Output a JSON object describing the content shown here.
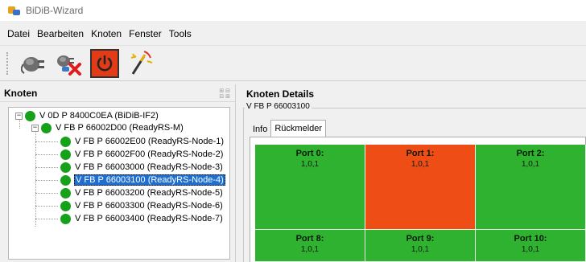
{
  "window": {
    "title": "BiDiB-Wizard"
  },
  "menu": [
    "Datei",
    "Bearbeiten",
    "Knoten",
    "Fenster",
    "Tools"
  ],
  "toolbar": {
    "buttons": [
      {
        "icon": "plug-connect-icon"
      },
      {
        "icon": "plug-disconnect-icon"
      },
      {
        "icon": "power-icon",
        "accent": "#e23b16"
      },
      {
        "icon": "magic-wand-icon"
      }
    ]
  },
  "left": {
    "header": "Knoten",
    "tree": [
      {
        "label": "V 0D P 8400C0EA (BiDiB-IF2)",
        "level": 0,
        "expander": "−"
      },
      {
        "label": "V FB P 66002D00 (ReadyRS-M)",
        "level": 1,
        "expander": "−"
      },
      {
        "label": "V FB P 66002E00 (ReadyRS-Node-1)",
        "level": 2
      },
      {
        "label": "V FB P 66002F00 (ReadyRS-Node-2)",
        "level": 2
      },
      {
        "label": "V FB P 66003000 (ReadyRS-Node-3)",
        "level": 2
      },
      {
        "label": "V FB P 66003100 (ReadyRS-Node-4)",
        "level": 2,
        "selected": true
      },
      {
        "label": "V FB P 66003200 (ReadyRS-Node-5)",
        "level": 2
      },
      {
        "label": "V FB P 66003300 (ReadyRS-Node-6)",
        "level": 2
      },
      {
        "label": "V FB P 66003400 (ReadyRS-Node-7)",
        "level": 2
      }
    ]
  },
  "right": {
    "header": "Knoten Details",
    "group_label": "V FB P 66003100",
    "tabs": [
      "Info",
      "Rückmelder"
    ],
    "active_tab": "Rückmelder",
    "ports": [
      {
        "name": "Port 0:",
        "value": "1,0,1",
        "state": "free"
      },
      {
        "name": "Port 1:",
        "value": "1,0,1",
        "state": "occupied"
      },
      {
        "name": "Port 2:",
        "value": "1,0,1",
        "state": "free"
      },
      {
        "name": "Port 8:",
        "value": "1,0,1",
        "state": "free"
      },
      {
        "name": "Port 9:",
        "value": "1,0,1",
        "state": "free"
      },
      {
        "name": "Port 10:",
        "value": "1,0,1",
        "state": "free"
      }
    ],
    "colors": {
      "free": "#2fb22f",
      "occupied": "#ee4d16",
      "node_dot": "#15a11a",
      "selection": "#1f6fd1"
    }
  }
}
